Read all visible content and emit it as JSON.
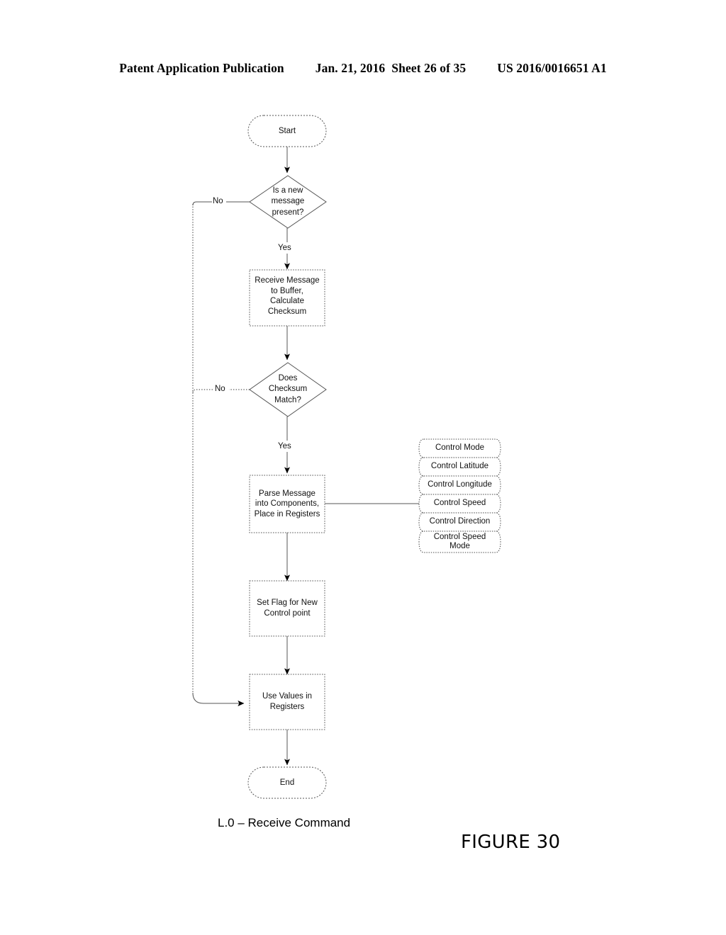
{
  "header": {
    "publication": "Patent Application Publication",
    "date": "Jan. 21, 2016",
    "sheet": "Sheet 26 of 35",
    "number": "US 2016/0016651 A1"
  },
  "flowchart": {
    "title": "L.0 – Receive Command",
    "figure": "FIGURE 30",
    "nodes": {
      "start": "Start",
      "decision_new_message": "Is a new\nmessage\npresent?",
      "receive_message": "Receive Message\nto Buffer,\nCalculate\nChecksum",
      "decision_checksum": "Does\nChecksum\nMatch?",
      "parse_message": "Parse Message\ninto Components,\nPlace in Registers",
      "set_flag": "Set Flag for New\nControl point",
      "use_values": "Use Values in\nRegisters",
      "end": "End"
    },
    "edge_labels": {
      "no_new_message": "No",
      "yes_new_message": "Yes",
      "no_checksum": "No",
      "yes_checksum": "Yes"
    },
    "registers": [
      {
        "label": "Control Mode"
      },
      {
        "label": "Control Latitude"
      },
      {
        "label": "Control Longitude"
      },
      {
        "label": "Control Speed"
      },
      {
        "label": "Control Direction"
      },
      {
        "label": "Control Speed\nMode"
      }
    ]
  },
  "style": {
    "line_color": "#555555",
    "dotted_color": "#333333",
    "text_color": "#111111"
  }
}
